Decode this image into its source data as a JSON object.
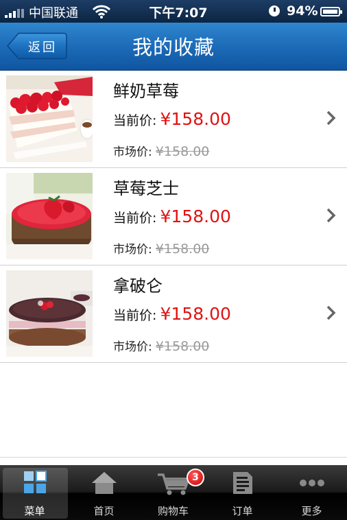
{
  "status_bar": {
    "carrier": "中国联通",
    "time": "下午7:07",
    "battery": "94%"
  },
  "nav": {
    "back_label": "返回",
    "title": "我的收藏"
  },
  "favorites": [
    {
      "name": "鲜奶草莓",
      "price_label": "当前价:",
      "price": "¥158.00",
      "market_label": "市场价:",
      "market_price": "¥158.00"
    },
    {
      "name": "草莓芝士",
      "price_label": "当前价:",
      "price": "¥158.00",
      "market_label": "市场价:",
      "market_price": "¥158.00"
    },
    {
      "name": "拿破仑",
      "price_label": "当前价:",
      "price": "¥158.00",
      "market_label": "市场价:",
      "market_price": "¥158.00"
    }
  ],
  "tabs": [
    {
      "label": "菜单",
      "icon": "grid-icon",
      "active": true
    },
    {
      "label": "首页",
      "icon": "home-icon"
    },
    {
      "label": "购物车",
      "icon": "cart-icon",
      "badge": "3"
    },
    {
      "label": "订单",
      "icon": "order-icon"
    },
    {
      "label": "更多",
      "icon": "more-icon"
    }
  ],
  "colors": {
    "nav": "#1d6bb8",
    "price": "#e01212",
    "badge": "#c80000"
  }
}
